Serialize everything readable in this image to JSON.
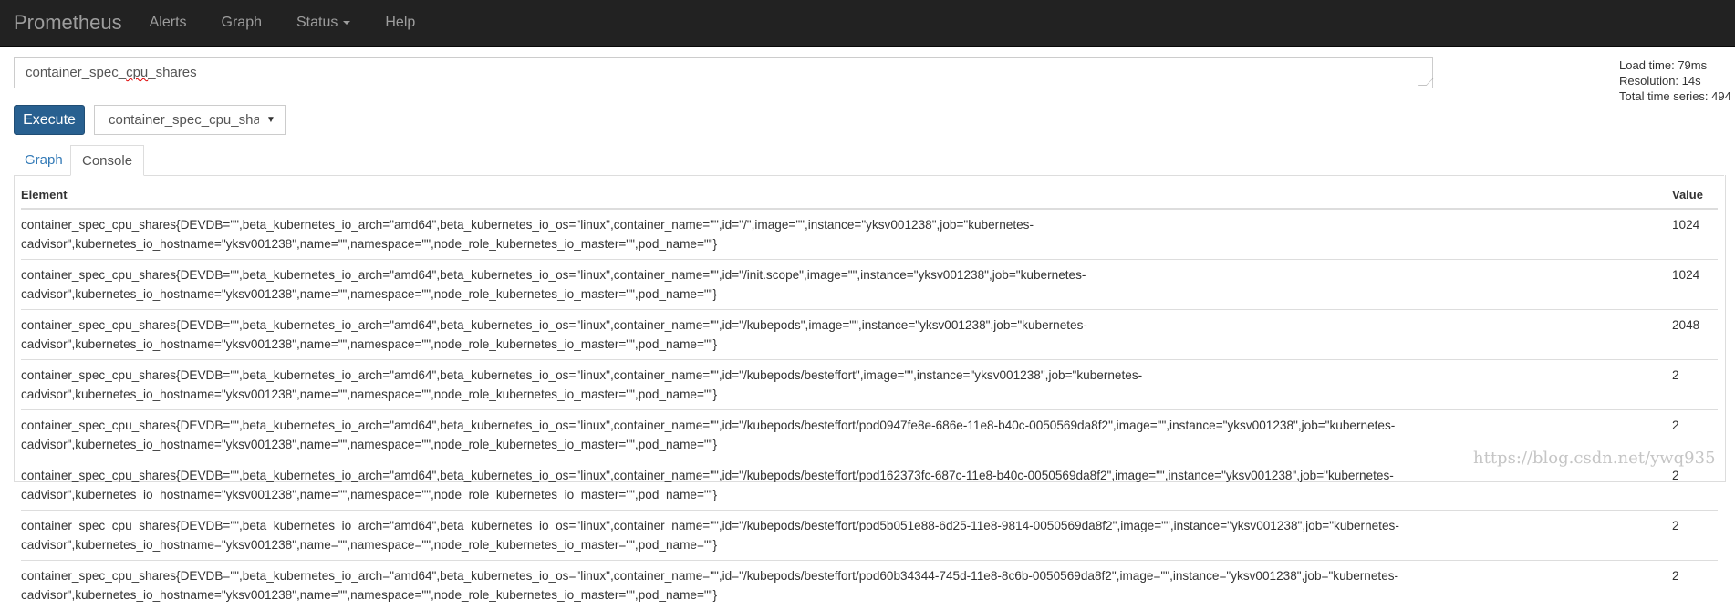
{
  "navbar": {
    "brand": "Prometheus",
    "items": [
      {
        "label": "Alerts"
      },
      {
        "label": "Graph"
      },
      {
        "label": "Status"
      },
      {
        "label": "Help"
      }
    ]
  },
  "query": {
    "text_before": "container_spec_",
    "text_misspelled": "cpu",
    "text_after": "_shares"
  },
  "stats": {
    "load_time": "Load time: 79ms",
    "resolution": "Resolution: 14s",
    "total_series": "Total time series: 494"
  },
  "execute_label": "Execute",
  "metric_select": {
    "selected": "container_spec_cpu_shares"
  },
  "tabs": [
    {
      "label": "Graph",
      "active": false
    },
    {
      "label": "Console",
      "active": true
    }
  ],
  "table": {
    "headers": {
      "element": "Element",
      "value": "Value"
    },
    "rows": [
      {
        "element": "container_spec_cpu_shares{DEVDB=\"\",beta_kubernetes_io_arch=\"amd64\",beta_kubernetes_io_os=\"linux\",container_name=\"\",id=\"/\",image=\"\",instance=\"yksv001238\",job=\"kubernetes-cadvisor\",kubernetes_io_hostname=\"yksv001238\",name=\"\",namespace=\"\",node_role_kubernetes_io_master=\"\",pod_name=\"\"}",
        "value": "1024"
      },
      {
        "element": "container_spec_cpu_shares{DEVDB=\"\",beta_kubernetes_io_arch=\"amd64\",beta_kubernetes_io_os=\"linux\",container_name=\"\",id=\"/init.scope\",image=\"\",instance=\"yksv001238\",job=\"kubernetes-cadvisor\",kubernetes_io_hostname=\"yksv001238\",name=\"\",namespace=\"\",node_role_kubernetes_io_master=\"\",pod_name=\"\"}",
        "value": "1024"
      },
      {
        "element": "container_spec_cpu_shares{DEVDB=\"\",beta_kubernetes_io_arch=\"amd64\",beta_kubernetes_io_os=\"linux\",container_name=\"\",id=\"/kubepods\",image=\"\",instance=\"yksv001238\",job=\"kubernetes-cadvisor\",kubernetes_io_hostname=\"yksv001238\",name=\"\",namespace=\"\",node_role_kubernetes_io_master=\"\",pod_name=\"\"}",
        "value": "2048"
      },
      {
        "element": "container_spec_cpu_shares{DEVDB=\"\",beta_kubernetes_io_arch=\"amd64\",beta_kubernetes_io_os=\"linux\",container_name=\"\",id=\"/kubepods/besteffort\",image=\"\",instance=\"yksv001238\",job=\"kubernetes-cadvisor\",kubernetes_io_hostname=\"yksv001238\",name=\"\",namespace=\"\",node_role_kubernetes_io_master=\"\",pod_name=\"\"}",
        "value": "2"
      },
      {
        "element": "container_spec_cpu_shares{DEVDB=\"\",beta_kubernetes_io_arch=\"amd64\",beta_kubernetes_io_os=\"linux\",container_name=\"\",id=\"/kubepods/besteffort/pod0947fe8e-686e-11e8-b40c-0050569da8f2\",image=\"\",instance=\"yksv001238\",job=\"kubernetes-cadvisor\",kubernetes_io_hostname=\"yksv001238\",name=\"\",namespace=\"\",node_role_kubernetes_io_master=\"\",pod_name=\"\"}",
        "value": "2"
      },
      {
        "element": "container_spec_cpu_shares{DEVDB=\"\",beta_kubernetes_io_arch=\"amd64\",beta_kubernetes_io_os=\"linux\",container_name=\"\",id=\"/kubepods/besteffort/pod162373fc-687c-11e8-b40c-0050569da8f2\",image=\"\",instance=\"yksv001238\",job=\"kubernetes-cadvisor\",kubernetes_io_hostname=\"yksv001238\",name=\"\",namespace=\"\",node_role_kubernetes_io_master=\"\",pod_name=\"\"}",
        "value": "2"
      },
      {
        "element": "container_spec_cpu_shares{DEVDB=\"\",beta_kubernetes_io_arch=\"amd64\",beta_kubernetes_io_os=\"linux\",container_name=\"\",id=\"/kubepods/besteffort/pod5b051e88-6d25-11e8-9814-0050569da8f2\",image=\"\",instance=\"yksv001238\",job=\"kubernetes-cadvisor\",kubernetes_io_hostname=\"yksv001238\",name=\"\",namespace=\"\",node_role_kubernetes_io_master=\"\",pod_name=\"\"}",
        "value": "2"
      },
      {
        "element": "container_spec_cpu_shares{DEVDB=\"\",beta_kubernetes_io_arch=\"amd64\",beta_kubernetes_io_os=\"linux\",container_name=\"\",id=\"/kubepods/besteffort/pod60b34344-745d-11e8-8c6b-0050569da8f2\",image=\"\",instance=\"yksv001238\",job=\"kubernetes-cadvisor\",kubernetes_io_hostname=\"yksv001238\",name=\"\",namespace=\"\",node_role_kubernetes_io_master=\"\",pod_name=\"\"}",
        "value": "2"
      }
    ]
  },
  "watermark": "https://blog.csdn.net/ywq935",
  "colors": {
    "navbar_bg": "#222222",
    "primary_button": "#286090",
    "link": "#337ab7"
  }
}
